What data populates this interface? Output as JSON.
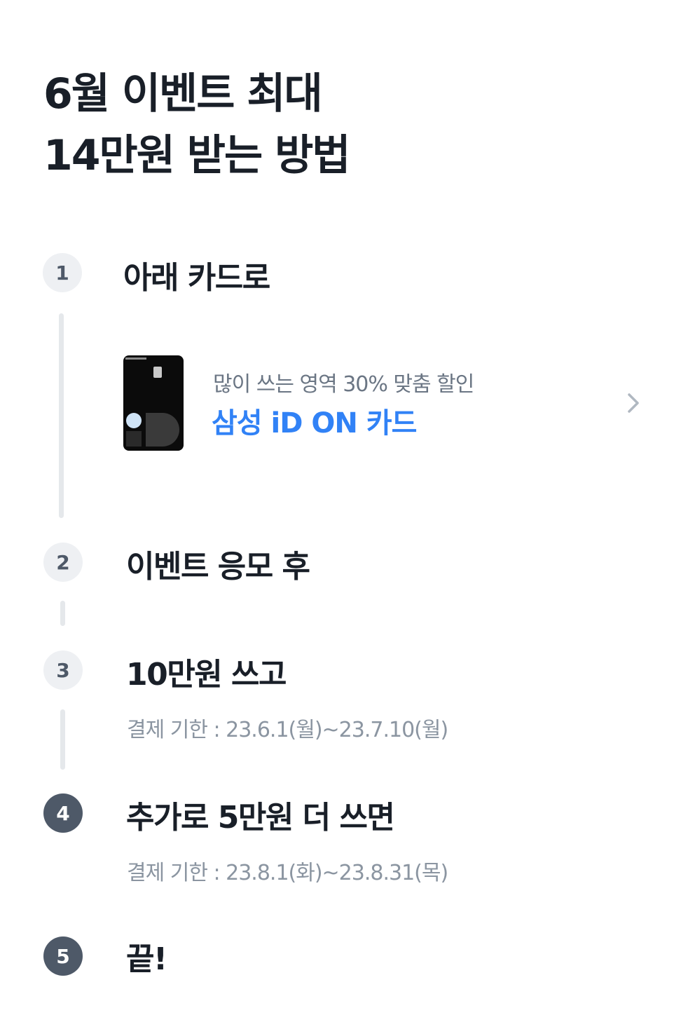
{
  "title": {
    "line1": "6월 이벤트 최대",
    "line2": "14만원 받는 방법"
  },
  "steps": [
    {
      "number": "1",
      "label": "아래 카드로",
      "note": ""
    },
    {
      "number": "2",
      "label": "이벤트 응모 후",
      "note": ""
    },
    {
      "number": "3",
      "label": "10만원 쓰고",
      "note": "결제 기한 : 23.6.1(월)~23.7.10(월)"
    },
    {
      "number": "4",
      "label": "추가로 5만원 더 쓰면",
      "note": "결제 기한 : 23.8.1(화)~23.8.31(목)"
    },
    {
      "number": "5",
      "label": "끝!",
      "note": ""
    }
  ],
  "card": {
    "subtitle": "많이 쓰는 영역 30% 맞춤 할인",
    "name": "삼성 iD ON 카드",
    "icon": "chevron-right-icon"
  },
  "colors": {
    "accent": "#3182f6",
    "active_step": "#4e5968",
    "inactive_step": "#eef0f3",
    "line": "#e5e8eb"
  }
}
